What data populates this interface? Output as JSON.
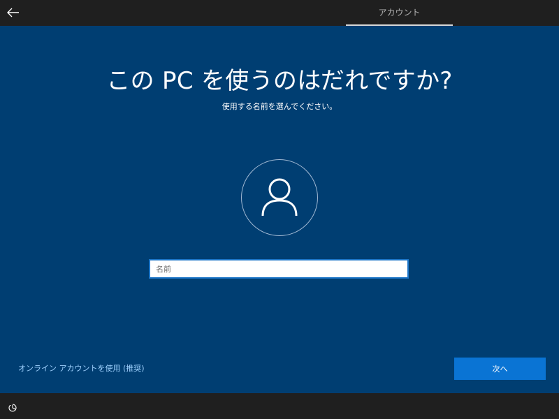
{
  "header": {
    "tab_label": "アカウント"
  },
  "main": {
    "title": "この PC を使うのはだれですか?",
    "subtitle": "使用する名前を選んでください。",
    "name_input": {
      "placeholder": "名前",
      "value": ""
    },
    "online_account_link": "オンライン アカウントを使用 (推奨)",
    "next_button": "次へ"
  },
  "icons": {
    "back": "back-arrow-icon",
    "avatar": "user-icon",
    "accessibility": "accessibility-icon"
  },
  "colors": {
    "background": "#003e72",
    "top_bar": "#1f1f1f",
    "accent": "#0a74d4",
    "link": "#9fd2ff"
  }
}
